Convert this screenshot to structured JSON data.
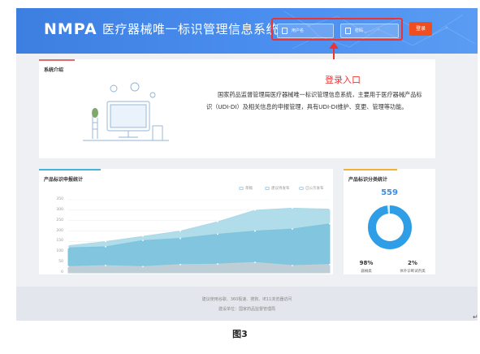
{
  "header": {
    "logo": "NMPA",
    "title": "医疗器械唯一标识管理信息系统",
    "username_placeholder": "用户名",
    "password_placeholder": "密码",
    "login_button": "登录"
  },
  "annotation": "登录入口",
  "intro": {
    "title": "系统介绍",
    "text": "国家药品监督管理局医疗器械唯一标识管理信息系统，主要用于医疗器械产品标识（UDI-DI）及相关信息的申报管理，具有UDI-DI维护、变更、管理等功能。"
  },
  "stats_card": {
    "title": "产品标识申报统计",
    "legend": [
      "草稿",
      "建议待发布",
      "已公示发布"
    ]
  },
  "classification_card": {
    "title": "产品标识分类统计",
    "total": "559",
    "items": [
      {
        "percent": "98%",
        "label": "器械类"
      },
      {
        "percent": "2%",
        "label": "体外诊断试剂类"
      }
    ]
  },
  "footer": {
    "line1": "建议使用谷歌、360极速、搜狗、IE11浏览器访问",
    "line2": "建设单位：国家药品监督管理局"
  },
  "caption": "图3",
  "chart_data": [
    {
      "type": "area",
      "title": "产品标识申报统计",
      "yticks": [
        "350",
        "300",
        "250",
        "200",
        "150",
        "100",
        "50",
        "0"
      ],
      "ylim": [
        0,
        350
      ],
      "x": [
        1,
        2,
        3,
        4,
        5,
        6,
        7,
        8
      ],
      "series": [
        {
          "name": "草稿",
          "values": [
            130,
            150,
            175,
            200,
            245,
            300,
            310,
            305
          ]
        },
        {
          "name": "建议待发布",
          "values": [
            120,
            125,
            155,
            165,
            185,
            200,
            210,
            235
          ]
        },
        {
          "name": "已公示发布",
          "values": [
            30,
            35,
            30,
            40,
            42,
            50,
            35,
            40
          ]
        }
      ],
      "colors": [
        "#a9d8e8",
        "#7cc3dd",
        "#c9cfd6"
      ]
    },
    {
      "type": "pie",
      "title": "产品标识分类统计",
      "categories": [
        "器械类",
        "体外诊断试剂类"
      ],
      "values": [
        98,
        2
      ],
      "colors": [
        "#2f9ee6",
        "#d9edf8"
      ]
    }
  ]
}
